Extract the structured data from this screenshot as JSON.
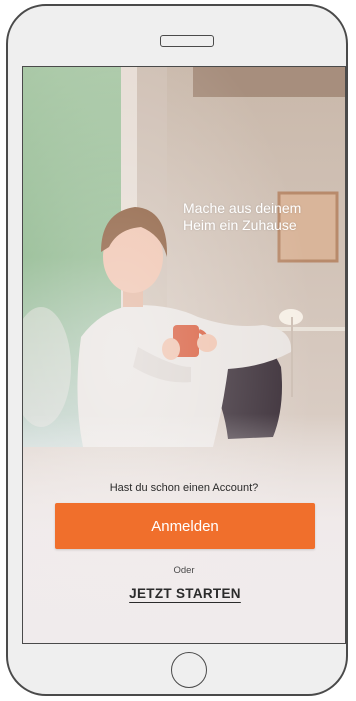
{
  "hero": {
    "tagline_line1": "Mache aus deinem",
    "tagline_line2": "Heim ein Zuhause"
  },
  "auth": {
    "account_question": "Hast du schon einen Account?",
    "login_label": "Anmelden",
    "or_label": "Oder",
    "start_label": "JETZT STARTEN"
  },
  "colors": {
    "accent": "#f06f2c",
    "text_dark": "#2b2b2b",
    "device_frame": "#4a4a4a"
  }
}
